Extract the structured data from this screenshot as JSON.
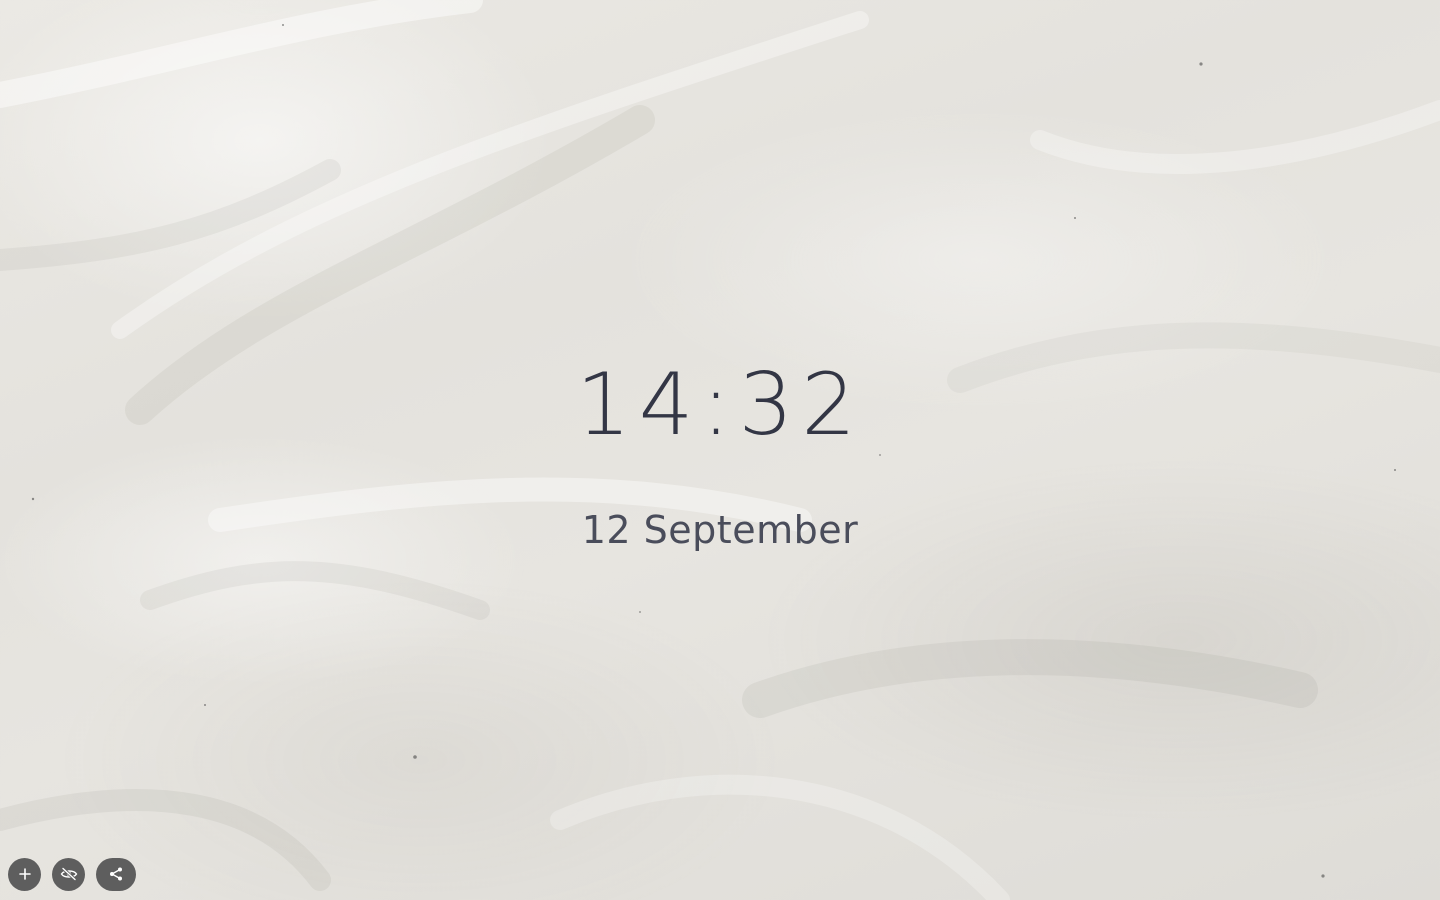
{
  "clock": {
    "time": "14:32",
    "date": "12 September"
  },
  "toolbar": {
    "buttons": [
      {
        "icon": "plus-icon"
      },
      {
        "icon": "eye-off-icon"
      },
      {
        "icon": "share-icon"
      }
    ]
  },
  "colors": {
    "time_text": "#333645",
    "date_text": "#4a4d5b",
    "button_bg": "#5e5e5e",
    "button_icon": "#ffffff"
  }
}
